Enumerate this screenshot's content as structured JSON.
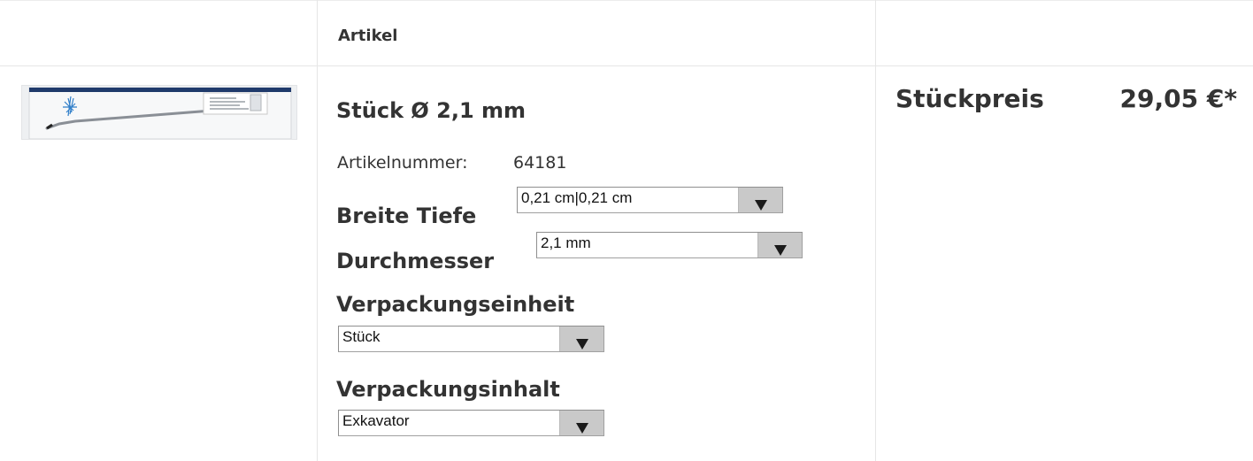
{
  "table": {
    "header": {
      "article_label": "Artikel",
      "unit_price_label": "Stückpreis"
    }
  },
  "product": {
    "image_icon": "dental-instrument-image",
    "title": "Stück Ø 2,1 mm",
    "sku_label": "Artikelnummer:",
    "sku_value": "64181",
    "price": "29,05 €*",
    "options": [
      {
        "label": "Breite Tiefe",
        "value": "0,21 cm|0,21 cm"
      },
      {
        "label": "Durchmesser",
        "value": "2,1 mm"
      },
      {
        "label": "Verpackungseinheit",
        "value": "Stück"
      },
      {
        "label": "Verpackungsinhalt",
        "value": "Exkavator"
      }
    ]
  },
  "colors": {
    "text": "#333333",
    "border": "#e6e6e6",
    "select_button": "#c9c9c9"
  }
}
